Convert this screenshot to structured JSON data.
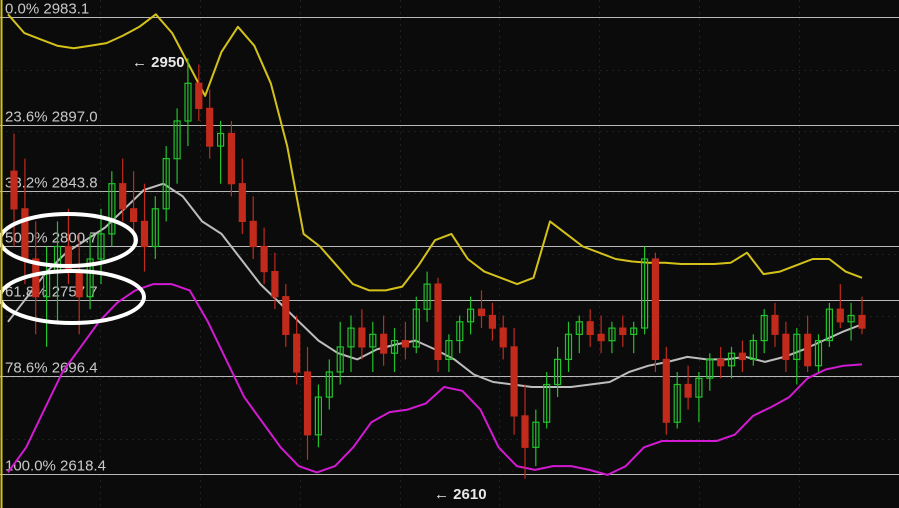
{
  "chart_data": {
    "type": "candlestick",
    "ylim": [
      2598,
      2990
    ],
    "grid": true,
    "colors": {
      "background": "#0b0b0b",
      "grid": "#1f1f1f",
      "up": "#22c22a",
      "down": "#c22a1c",
      "upper_band": "#d4c21a",
      "middle_band": "#bdbdbd",
      "lower_band": "#d21ad2",
      "fib_line": "#b8b8b8",
      "ellipse": "#ffffff"
    },
    "fib_levels": [
      {
        "pct": "0.0%",
        "value": 2983.1,
        "label": "0.0% 2983.1"
      },
      {
        "pct": "23.6%",
        "value": 2897.0,
        "label": "23.6% 2897.0"
      },
      {
        "pct": "38.2%",
        "value": 2843.8,
        "label": "38.2% 2843.8"
      },
      {
        "pct": "50.0%",
        "value": 2800.7,
        "label": "50.0% 2800.7"
      },
      {
        "pct": "61.8%",
        "value": 2757.7,
        "label": "61.8% 2757.7"
      },
      {
        "pct": "78.6%",
        "value": 2696.4,
        "label": "78.6% 2696.4"
      },
      {
        "pct": "100.0%",
        "value": 2618.4,
        "label": "100.0% 2618.4"
      }
    ],
    "annotations": [
      {
        "text": "← 2950",
        "value": 2950
      },
      {
        "text": "← 2610",
        "value": 2610
      }
    ],
    "highlighted_levels": [
      "50.0%",
      "61.8%"
    ],
    "candles": [
      [
        2860,
        2890,
        2800,
        2830
      ],
      [
        2830,
        2870,
        2770,
        2790
      ],
      [
        2790,
        2820,
        2730,
        2760
      ],
      [
        2760,
        2800,
        2720,
        2780
      ],
      [
        2780,
        2820,
        2740,
        2800
      ],
      [
        2800,
        2830,
        2770,
        2780
      ],
      [
        2780,
        2810,
        2730,
        2760
      ],
      [
        2760,
        2810,
        2750,
        2790
      ],
      [
        2790,
        2830,
        2770,
        2810
      ],
      [
        2810,
        2860,
        2800,
        2850
      ],
      [
        2850,
        2870,
        2820,
        2830
      ],
      [
        2830,
        2860,
        2800,
        2820
      ],
      [
        2820,
        2850,
        2780,
        2800
      ],
      [
        2800,
        2840,
        2790,
        2830
      ],
      [
        2830,
        2880,
        2820,
        2870
      ],
      [
        2870,
        2910,
        2850,
        2900
      ],
      [
        2900,
        2950,
        2880,
        2930
      ],
      [
        2930,
        2945,
        2900,
        2910
      ],
      [
        2910,
        2925,
        2870,
        2880
      ],
      [
        2880,
        2900,
        2850,
        2890
      ],
      [
        2890,
        2900,
        2840,
        2850
      ],
      [
        2850,
        2870,
        2810,
        2820
      ],
      [
        2820,
        2840,
        2790,
        2800
      ],
      [
        2800,
        2815,
        2770,
        2780
      ],
      [
        2780,
        2795,
        2750,
        2760
      ],
      [
        2760,
        2770,
        2720,
        2730
      ],
      [
        2730,
        2745,
        2690,
        2700
      ],
      [
        2700,
        2720,
        2630,
        2650
      ],
      [
        2650,
        2690,
        2640,
        2680
      ],
      [
        2680,
        2710,
        2670,
        2700
      ],
      [
        2700,
        2740,
        2690,
        2720
      ],
      [
        2720,
        2745,
        2700,
        2735
      ],
      [
        2735,
        2750,
        2710,
        2720
      ],
      [
        2720,
        2740,
        2700,
        2730
      ],
      [
        2730,
        2745,
        2705,
        2715
      ],
      [
        2715,
        2735,
        2700,
        2725
      ],
      [
        2725,
        2740,
        2710,
        2720
      ],
      [
        2720,
        2760,
        2715,
        2750
      ],
      [
        2750,
        2780,
        2740,
        2770
      ],
      [
        2770,
        2775,
        2700,
        2710
      ],
      [
        2710,
        2730,
        2700,
        2725
      ],
      [
        2725,
        2745,
        2715,
        2740
      ],
      [
        2740,
        2760,
        2730,
        2750
      ],
      [
        2750,
        2765,
        2735,
        2745
      ],
      [
        2745,
        2755,
        2725,
        2735
      ],
      [
        2735,
        2745,
        2710,
        2720
      ],
      [
        2720,
        2735,
        2650,
        2665
      ],
      [
        2665,
        2690,
        2615,
        2640
      ],
      [
        2640,
        2670,
        2625,
        2660
      ],
      [
        2660,
        2700,
        2655,
        2690
      ],
      [
        2690,
        2720,
        2680,
        2710
      ],
      [
        2710,
        2740,
        2700,
        2730
      ],
      [
        2730,
        2745,
        2715,
        2740
      ],
      [
        2740,
        2750,
        2720,
        2730
      ],
      [
        2730,
        2745,
        2715,
        2725
      ],
      [
        2725,
        2740,
        2715,
        2735
      ],
      [
        2735,
        2745,
        2720,
        2730
      ],
      [
        2730,
        2740,
        2715,
        2735
      ],
      [
        2735,
        2800,
        2730,
        2790
      ],
      [
        2790,
        2795,
        2700,
        2710
      ],
      [
        2710,
        2720,
        2650,
        2660
      ],
      [
        2660,
        2700,
        2655,
        2690
      ],
      [
        2690,
        2705,
        2670,
        2680
      ],
      [
        2680,
        2700,
        2660,
        2695
      ],
      [
        2695,
        2715,
        2685,
        2710
      ],
      [
        2710,
        2720,
        2695,
        2705
      ],
      [
        2705,
        2720,
        2695,
        2715
      ],
      [
        2715,
        2725,
        2700,
        2710
      ],
      [
        2710,
        2730,
        2705,
        2725
      ],
      [
        2725,
        2750,
        2715,
        2745
      ],
      [
        2745,
        2755,
        2720,
        2730
      ],
      [
        2730,
        2740,
        2700,
        2710
      ],
      [
        2710,
        2735,
        2690,
        2730
      ],
      [
        2730,
        2745,
        2700,
        2705
      ],
      [
        2705,
        2730,
        2700,
        2725
      ],
      [
        2725,
        2755,
        2720,
        2750
      ],
      [
        2750,
        2770,
        2735,
        2740
      ],
      [
        2740,
        2755,
        2725,
        2745
      ],
      [
        2745,
        2760,
        2730,
        2735
      ]
    ],
    "upper_band": [
      2985,
      2970,
      2965,
      2960,
      2958,
      2960,
      2962,
      2968,
      2975,
      2985,
      2970,
      2945,
      2920,
      2955,
      2975,
      2960,
      2930,
      2880,
      2810,
      2800,
      2785,
      2770,
      2765,
      2765,
      2768,
      2785,
      2805,
      2810,
      2790,
      2780,
      2775,
      2770,
      2775,
      2820,
      2810,
      2800,
      2795,
      2790,
      2788,
      2787,
      2787,
      2786,
      2786,
      2786,
      2787,
      2795,
      2778,
      2780,
      2785,
      2790,
      2790,
      2780,
      2775
    ],
    "middle_band": [
      2740,
      2760,
      2780,
      2795,
      2805,
      2815,
      2830,
      2845,
      2850,
      2840,
      2820,
      2810,
      2790,
      2770,
      2755,
      2740,
      2725,
      2715,
      2710,
      2718,
      2722,
      2725,
      2718,
      2710,
      2698,
      2692,
      2690,
      2688,
      2688,
      2688,
      2690,
      2692,
      2700,
      2705,
      2708,
      2712,
      2710,
      2710,
      2712,
      2708,
      2712,
      2718,
      2725,
      2732,
      2738
    ],
    "lower_band": [
      2620,
      2640,
      2670,
      2700,
      2720,
      2740,
      2755,
      2765,
      2770,
      2770,
      2765,
      2740,
      2710,
      2680,
      2660,
      2640,
      2625,
      2620,
      2625,
      2640,
      2660,
      2668,
      2670,
      2675,
      2688,
      2685,
      2670,
      2640,
      2625,
      2622,
      2625,
      2625,
      2622,
      2618,
      2625,
      2640,
      2645,
      2645,
      2645,
      2645,
      2650,
      2665,
      2672,
      2680,
      2695,
      2702,
      2705,
      2706
    ]
  }
}
